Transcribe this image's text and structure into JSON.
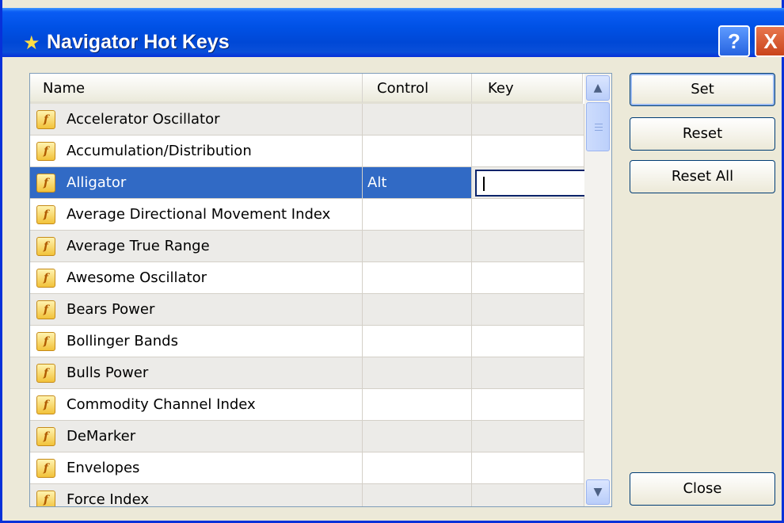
{
  "window": {
    "title": "Navigator Hot Keys",
    "help_label": "?",
    "close_label": "X"
  },
  "columns": {
    "name": "Name",
    "control": "Control",
    "key": "Key"
  },
  "rows": [
    {
      "name": "Accelerator Oscillator",
      "control": "",
      "key": ""
    },
    {
      "name": "Accumulation/Distribution",
      "control": "",
      "key": ""
    },
    {
      "name": "Alligator",
      "control": "Alt",
      "key": ""
    },
    {
      "name": "Average Directional Movement Index",
      "control": "",
      "key": ""
    },
    {
      "name": "Average True Range",
      "control": "",
      "key": ""
    },
    {
      "name": "Awesome Oscillator",
      "control": "",
      "key": ""
    },
    {
      "name": "Bears Power",
      "control": "",
      "key": ""
    },
    {
      "name": "Bollinger Bands",
      "control": "",
      "key": ""
    },
    {
      "name": "Bulls Power",
      "control": "",
      "key": ""
    },
    {
      "name": "Commodity Channel Index",
      "control": "",
      "key": ""
    },
    {
      "name": "DeMarker",
      "control": "",
      "key": ""
    },
    {
      "name": "Envelopes",
      "control": "",
      "key": ""
    },
    {
      "name": "Force Index",
      "control": "",
      "key": ""
    }
  ],
  "selected_row": "Alligator",
  "icons": {
    "row_icon": "function-icon",
    "row_icon_glyph": "f"
  },
  "buttons": {
    "set": "Set",
    "reset": "Reset",
    "reset_all": "Reset All",
    "close": "Close"
  },
  "colors": {
    "titlebar": "#0054e3",
    "selection": "#316ac5",
    "dialog_bg": "#ece9d8"
  }
}
